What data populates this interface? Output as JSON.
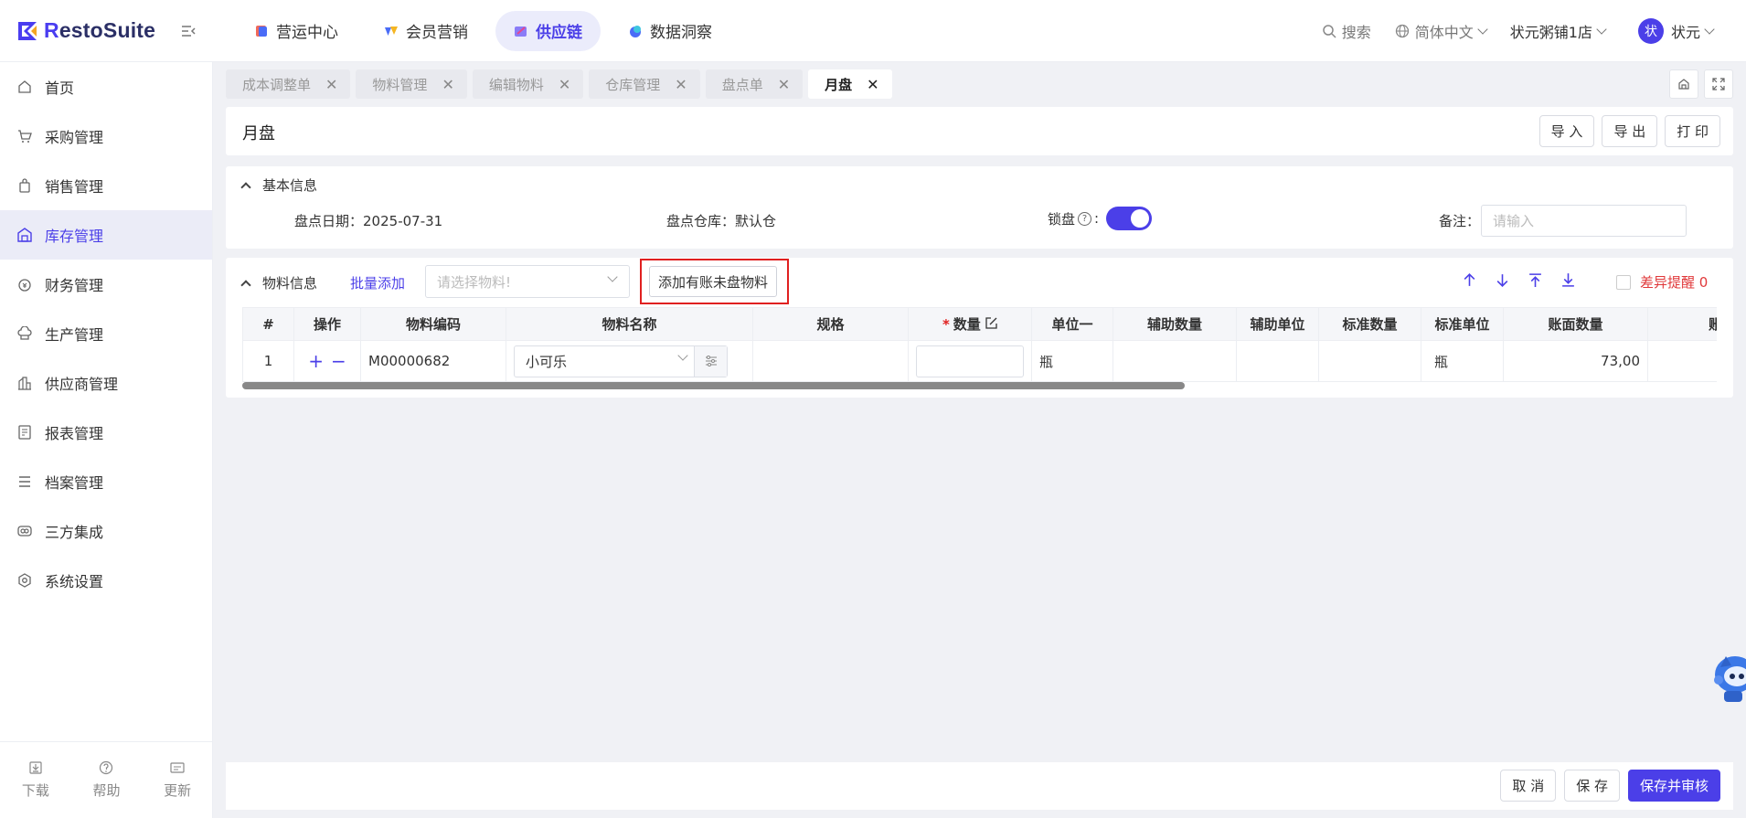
{
  "brand": {
    "name_prefix": "R",
    "name_rest": "estoSuite"
  },
  "nav": [
    {
      "label": "营运中心",
      "active": false
    },
    {
      "label": "会员营销",
      "active": false
    },
    {
      "label": "供应链",
      "active": true
    },
    {
      "label": "数据洞察",
      "active": false
    }
  ],
  "topright": {
    "search": "搜索",
    "language": "简体中文",
    "store": "状元粥铺1店",
    "avatar": "状",
    "user": "状元"
  },
  "sidebar": {
    "items": [
      {
        "label": "首页",
        "icon": "home-icon"
      },
      {
        "label": "采购管理",
        "icon": "cart-icon"
      },
      {
        "label": "销售管理",
        "icon": "bag-icon"
      },
      {
        "label": "库存管理",
        "icon": "warehouse-icon",
        "active": true
      },
      {
        "label": "财务管理",
        "icon": "money-icon"
      },
      {
        "label": "生产管理",
        "icon": "chef-hat-icon"
      },
      {
        "label": "供应商管理",
        "icon": "building-icon"
      },
      {
        "label": "报表管理",
        "icon": "report-icon"
      },
      {
        "label": "档案管理",
        "icon": "list-icon"
      },
      {
        "label": "三方集成",
        "icon": "integration-icon"
      },
      {
        "label": "系统设置",
        "icon": "settings-icon"
      }
    ],
    "bottom": [
      {
        "label": "下载",
        "icon": "download-icon"
      },
      {
        "label": "帮助",
        "icon": "help-icon"
      },
      {
        "label": "更新",
        "icon": "update-icon"
      }
    ]
  },
  "tabs": [
    {
      "label": "成本调整单"
    },
    {
      "label": "物料管理"
    },
    {
      "label": "编辑物料"
    },
    {
      "label": "仓库管理"
    },
    {
      "label": "盘点单"
    },
    {
      "label": "月盘",
      "active": true
    }
  ],
  "page": {
    "title": "月盘",
    "import": "导 入",
    "export": "导 出",
    "print": "打 印"
  },
  "basic": {
    "heading": "基本信息",
    "date_label": "盘点日期：",
    "date_value": "2025-07-31",
    "warehouse_label": "盘点仓库：",
    "warehouse_value": "默认仓",
    "lock_label": "锁盘",
    "lock_colon": ":",
    "lock_on": true,
    "remark_label": "备注：",
    "remark_placeholder": "请输入"
  },
  "items": {
    "heading": "物料信息",
    "batch_add": "批量添加",
    "select_placeholder": "请选择物料!",
    "add_unaccounted": "添加有账未盘物料",
    "diff_label": "差异提醒 0",
    "columns": [
      "#",
      "操作",
      "物料编码",
      "物料名称",
      "规格",
      "数量",
      "单位一",
      "辅助数量",
      "辅助单位",
      "标准数量",
      "标准单位",
      "账面数量",
      "账面"
    ],
    "rows": [
      {
        "index": "1",
        "code": "M00000682",
        "name": "小可乐",
        "spec": "",
        "qty": "",
        "unit1": "瓶",
        "aux_qty": "",
        "aux_unit": "",
        "std_qty": "",
        "std_unit": "瓶",
        "book_qty": "73,00",
        "book_more": ""
      }
    ],
    "op_add": "+",
    "op_remove": "−"
  },
  "footer": {
    "cancel": "取 消",
    "save": "保 存",
    "save_audit": "保存并审核"
  },
  "colors": {
    "accent": "#4b3fe8",
    "danger": "#e02020"
  }
}
